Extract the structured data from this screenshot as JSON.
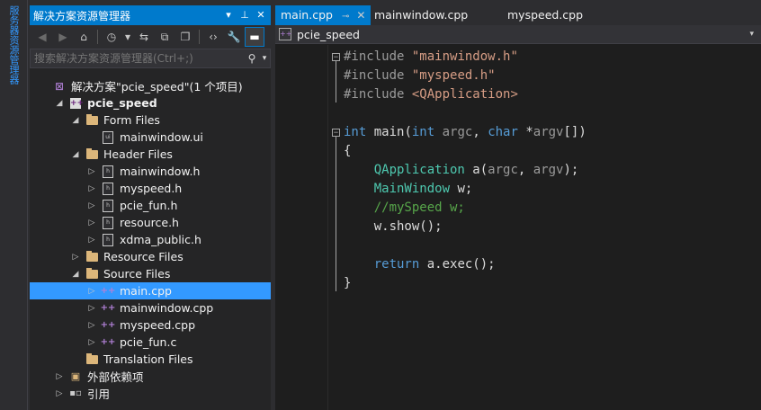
{
  "side_strip": {
    "label": "服务器资源管理器"
  },
  "solution_explorer": {
    "title": "解决方案资源管理器",
    "search_placeholder": "搜索解决方案资源管理器(Ctrl+;)",
    "tree": [
      {
        "label": "解决方案\"pcie_speed\"(1 个项目)",
        "level": 0,
        "expander": "",
        "icon": "solution-icon"
      },
      {
        "label": "pcie_speed",
        "level": 1,
        "expander": "expanded",
        "icon": "project-icon",
        "bold": true
      },
      {
        "label": "Form Files",
        "level": 2,
        "expander": "expanded",
        "icon": "folder-icon"
      },
      {
        "label": "mainwindow.ui",
        "level": 3,
        "expander": "",
        "icon": "ui-file-icon"
      },
      {
        "label": "Header Files",
        "level": 2,
        "expander": "expanded",
        "icon": "folder-icon"
      },
      {
        "label": "mainwindow.h",
        "level": 3,
        "expander": "collapsed",
        "icon": "header-file-icon"
      },
      {
        "label": "myspeed.h",
        "level": 3,
        "expander": "collapsed",
        "icon": "header-file-icon"
      },
      {
        "label": "pcie_fun.h",
        "level": 3,
        "expander": "collapsed",
        "icon": "header-file-icon"
      },
      {
        "label": "resource.h",
        "level": 3,
        "expander": "collapsed",
        "icon": "header-file-icon"
      },
      {
        "label": "xdma_public.h",
        "level": 3,
        "expander": "collapsed",
        "icon": "header-file-icon"
      },
      {
        "label": "Resource Files",
        "level": 2,
        "expander": "collapsed",
        "icon": "folder-icon"
      },
      {
        "label": "Source Files",
        "level": 2,
        "expander": "expanded",
        "icon": "folder-icon"
      },
      {
        "label": "main.cpp",
        "level": 3,
        "expander": "collapsed",
        "icon": "cpp-file-icon",
        "selected": true
      },
      {
        "label": "mainwindow.cpp",
        "level": 3,
        "expander": "collapsed",
        "icon": "cpp-file-icon"
      },
      {
        "label": "myspeed.cpp",
        "level": 3,
        "expander": "collapsed",
        "icon": "cpp-file-icon"
      },
      {
        "label": "pcie_fun.c",
        "level": 3,
        "expander": "collapsed",
        "icon": "cpp-file-icon"
      },
      {
        "label": "Translation Files",
        "level": 2,
        "expander": "",
        "icon": "folder-icon"
      },
      {
        "label": "外部依赖项",
        "level": 1,
        "expander": "collapsed",
        "icon": "dependencies-icon"
      },
      {
        "label": "引用",
        "level": 1,
        "expander": "collapsed",
        "icon": "references-icon"
      }
    ]
  },
  "editor": {
    "tabs": [
      {
        "label": "main.cpp",
        "active": true
      },
      {
        "label": "mainwindow.cpp",
        "active": false
      },
      {
        "label": "myspeed.cpp",
        "active": false
      }
    ],
    "nav_scope": "pcie_speed",
    "code_lines": [
      "#include \"mainwindow.h\"",
      "#include \"myspeed.h\"",
      "#include <QApplication>",
      "",
      "int main(int argc, char *argv[])",
      "{",
      "    QApplication a(argc, argv);",
      "    MainWindow w;",
      "    //mySpeed w;",
      "    w.show();",
      "",
      "    return a.exec();",
      "}"
    ]
  }
}
